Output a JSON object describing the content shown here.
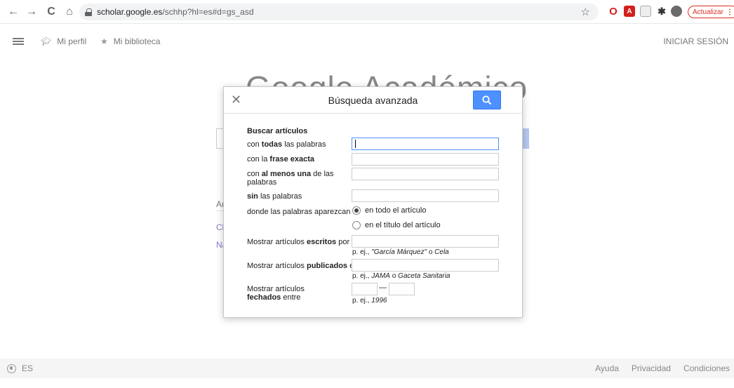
{
  "browser": {
    "url_host": "scholar.google.es",
    "url_path": "/schhp?hl=es#d=gs_asd",
    "update_label": "Actualizar",
    "update_menu": "⋮"
  },
  "header": {
    "profile": "Mi perfil",
    "library": "Mi biblioteca",
    "signin": "INICIAR SESIÓN"
  },
  "background": {
    "logo": "Google Académico",
    "frag_a": "Ar",
    "frag_c": "Cl",
    "frag_n": "Na"
  },
  "footer": {
    "lang": "ES",
    "links": [
      "Ayuda",
      "Privacidad",
      "Condiciones"
    ]
  },
  "dialog": {
    "title": "Búsqueda avanzada",
    "section": "Buscar artículos",
    "fields": {
      "all_words": {
        "pre": "con ",
        "bold": "todas",
        "post": " las palabras",
        "value": ""
      },
      "exact_phrase": {
        "pre": "con la ",
        "bold": "frase exacta",
        "post": "",
        "value": ""
      },
      "at_least_one": {
        "pre": "con ",
        "bold": "al menos una",
        "post": " de las palabras",
        "value": ""
      },
      "without": {
        "pre": "",
        "bold": "sin",
        "post": " las palabras",
        "value": ""
      },
      "where_label": "donde las palabras aparezcan",
      "where_options": [
        "en todo el artículo",
        "en el título del artículo"
      ],
      "where_selected": 0,
      "authors": {
        "pre": "Mostrar artículos ",
        "bold": "escritos",
        "post": " por",
        "value": "",
        "hint_pre": "p. ej., ",
        "hint_em1": "\"García Márquez\"",
        "hint_mid": " o ",
        "hint_em2": "Cela"
      },
      "published": {
        "pre": "Mostrar artículos ",
        "bold": "publicados",
        "post": " en",
        "value": "",
        "hint_pre": "p. ej., ",
        "hint_em1": "JAMA",
        "hint_mid": " o ",
        "hint_em2": "Gaceta Sanitaria"
      },
      "dated": {
        "pre": "Mostrar artículos ",
        "bold": "fechados",
        "post": " entre",
        "from": "",
        "to": "",
        "dash": "—",
        "hint_pre": "p. ej., ",
        "hint_em1": "1996"
      }
    }
  }
}
